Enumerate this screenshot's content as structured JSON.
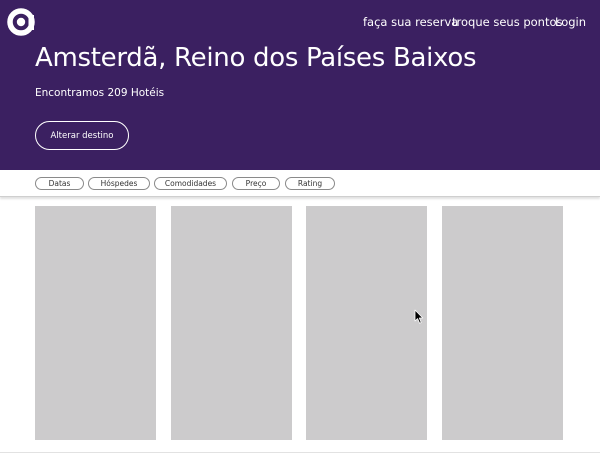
{
  "header": {
    "logo_icon": "brand-logo-icon",
    "nav": [
      {
        "label": "faça sua reserva"
      },
      {
        "label": "troque seus pontos"
      },
      {
        "label": "Login"
      }
    ]
  },
  "hero": {
    "title": "Amsterdã, Reino dos Países Baixos",
    "subtitle": "Encontramos 209 Hotéis",
    "change_destination_label": "Alterar destino",
    "background_color": "#3b2061"
  },
  "filters": [
    {
      "label": "Datas"
    },
    {
      "label": "Hóspedes"
    },
    {
      "label": "Comodidades"
    },
    {
      "label": "Preço"
    },
    {
      "label": "Rating"
    }
  ],
  "results": {
    "card_count": 4,
    "card_color": "#cccbcc"
  },
  "cursor_icon": "mouse-pointer-icon"
}
